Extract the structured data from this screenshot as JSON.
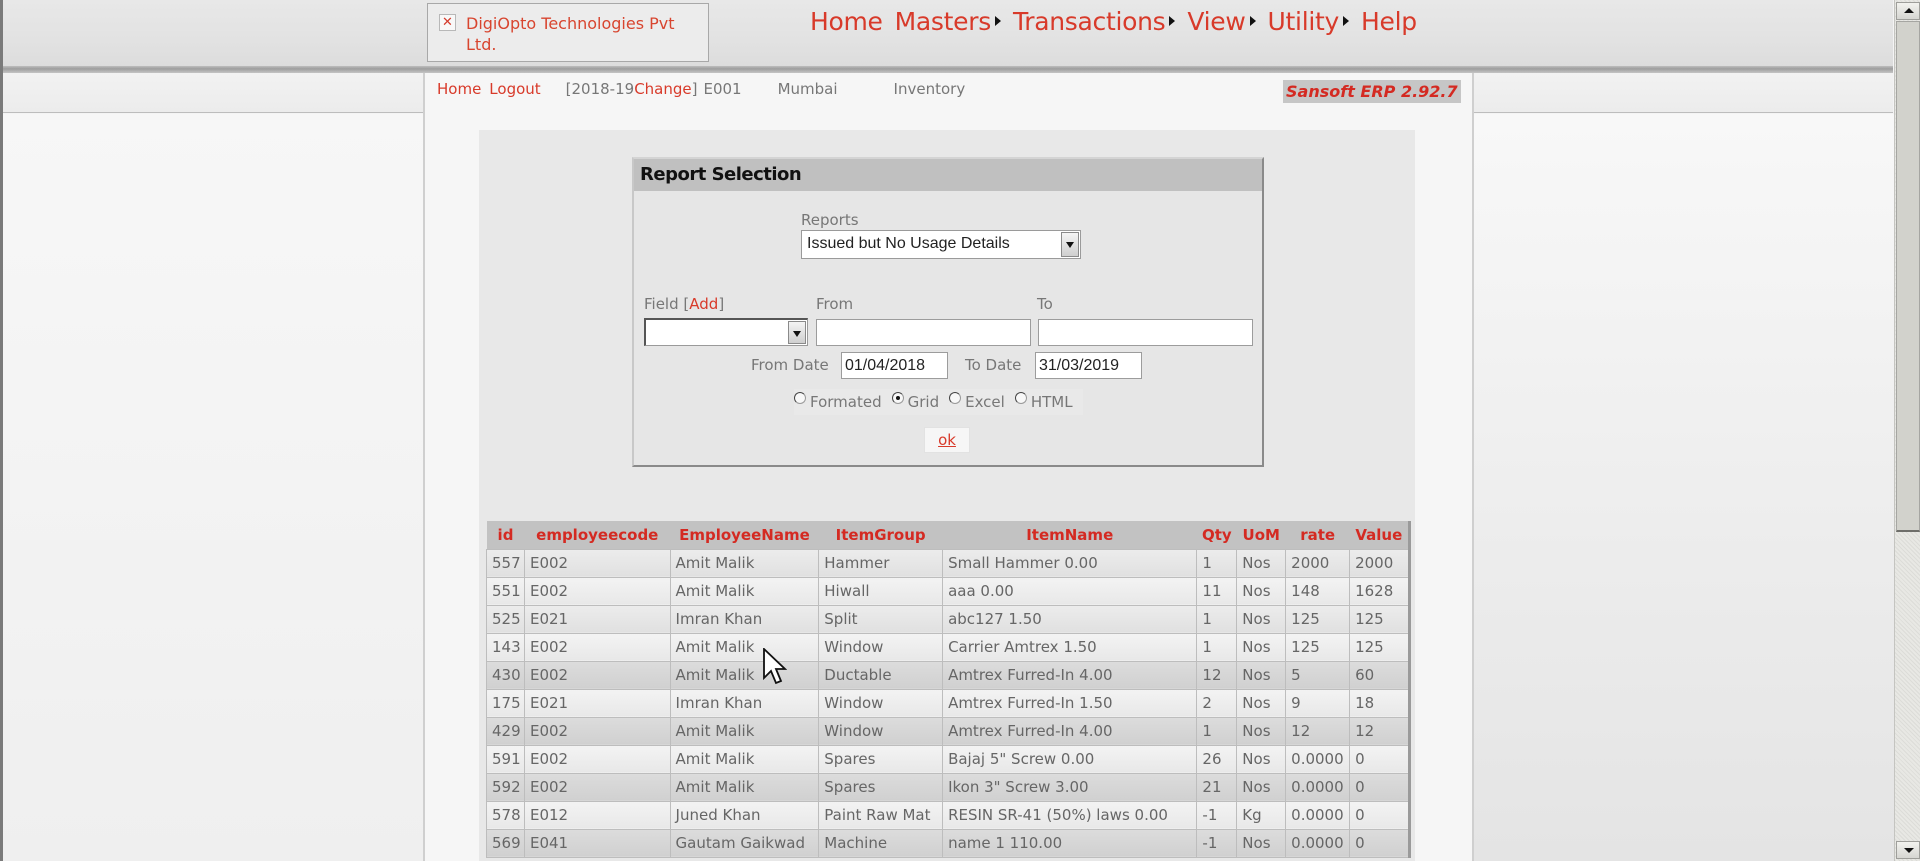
{
  "header": {
    "company": "DigiOpto Technologies Pvt Ltd.",
    "menu": [
      {
        "label": "Home",
        "has_submenu": false
      },
      {
        "label": "Masters",
        "has_submenu": true
      },
      {
        "label": "Transactions",
        "has_submenu": true
      },
      {
        "label": "View",
        "has_submenu": true
      },
      {
        "label": "Utility",
        "has_submenu": true
      },
      {
        "label": "Help",
        "has_submenu": false
      }
    ]
  },
  "subnav": {
    "home": "Home",
    "logout": "Logout",
    "year_prefix": "[2018-19",
    "change": "Change",
    "year_suffix": "]",
    "employee": "E001",
    "location": "Mumbai",
    "module": "Inventory",
    "version": "Sansoft ERP 2.92.7"
  },
  "report_selection": {
    "title": "Report Selection",
    "reports_label": "Reports",
    "reports_value": "Issued but No Usage Details",
    "field_label": "Field",
    "add_open": "[",
    "add_label": "Add",
    "add_close": "]",
    "field_value": "",
    "from_label": "From",
    "from_value": "",
    "to_label": "To",
    "to_value": "",
    "from_date_label": "From Date",
    "from_date": "01/04/2018",
    "to_date_label": "To Date",
    "to_date": "31/03/2019",
    "output_options": [
      {
        "label": "Formated",
        "selected": false
      },
      {
        "label": "Grid",
        "selected": true
      },
      {
        "label": "Excel",
        "selected": false
      },
      {
        "label": "HTML",
        "selected": false
      }
    ],
    "ok_label": "ok"
  },
  "grid": {
    "columns": [
      "id",
      "employeecode",
      "EmployeeName",
      "ItemGroup",
      "ItemName",
      "Qty",
      "UoM",
      "rate",
      "Value"
    ],
    "rows": [
      [
        "557",
        "E002",
        "Amit Malik",
        "Hammer",
        "Small Hammer 0.00",
        "1",
        "Nos",
        "2000",
        "2000"
      ],
      [
        "551",
        "E002",
        "Amit Malik",
        "Hiwall",
        "aaa 0.00",
        "11",
        "Nos",
        "148",
        "1628"
      ],
      [
        "525",
        "E021",
        "Imran Khan",
        "Split",
        "abc127 1.50",
        "1",
        "Nos",
        "125",
        "125"
      ],
      [
        "143",
        "E002",
        "Amit Malik",
        "Window",
        "Carrier Amtrex 1.50",
        "1",
        "Nos",
        "125",
        "125"
      ],
      [
        "430",
        "E002",
        "Amit Malik",
        "Ductable",
        "Amtrex Furred-In 4.00",
        "12",
        "Nos",
        "5",
        "60"
      ],
      [
        "175",
        "E021",
        "Imran Khan",
        "Window",
        "Amtrex Furred-In 1.50",
        "2",
        "Nos",
        "9",
        "18"
      ],
      [
        "429",
        "E002",
        "Amit Malik",
        "Window",
        "Amtrex Furred-In 4.00",
        "1",
        "Nos",
        "12",
        "12"
      ],
      [
        "591",
        "E002",
        "Amit Malik",
        "Spares",
        "Bajaj 5\" Screw 0.00",
        "26",
        "Nos",
        "0.0000",
        "0"
      ],
      [
        "592",
        "E002",
        "Amit Malik",
        "Spares",
        "Ikon 3\" Screw 3.00",
        "21",
        "Nos",
        "0.0000",
        "0"
      ],
      [
        "578",
        "E012",
        "Juned Khan",
        "Paint Raw Mat",
        "RESIN SR-41 (50%) laws 0.00",
        "-1",
        "Kg",
        "0.0000",
        "0"
      ],
      [
        "569",
        "E041",
        "Gautam Gaikwad",
        "Machine",
        "name 1 110.00",
        "-1",
        "Nos",
        "0.0000",
        "0"
      ]
    ]
  },
  "colors": {
    "accent_red": "#d83a2a",
    "header_gray": "#c2c2c2"
  }
}
